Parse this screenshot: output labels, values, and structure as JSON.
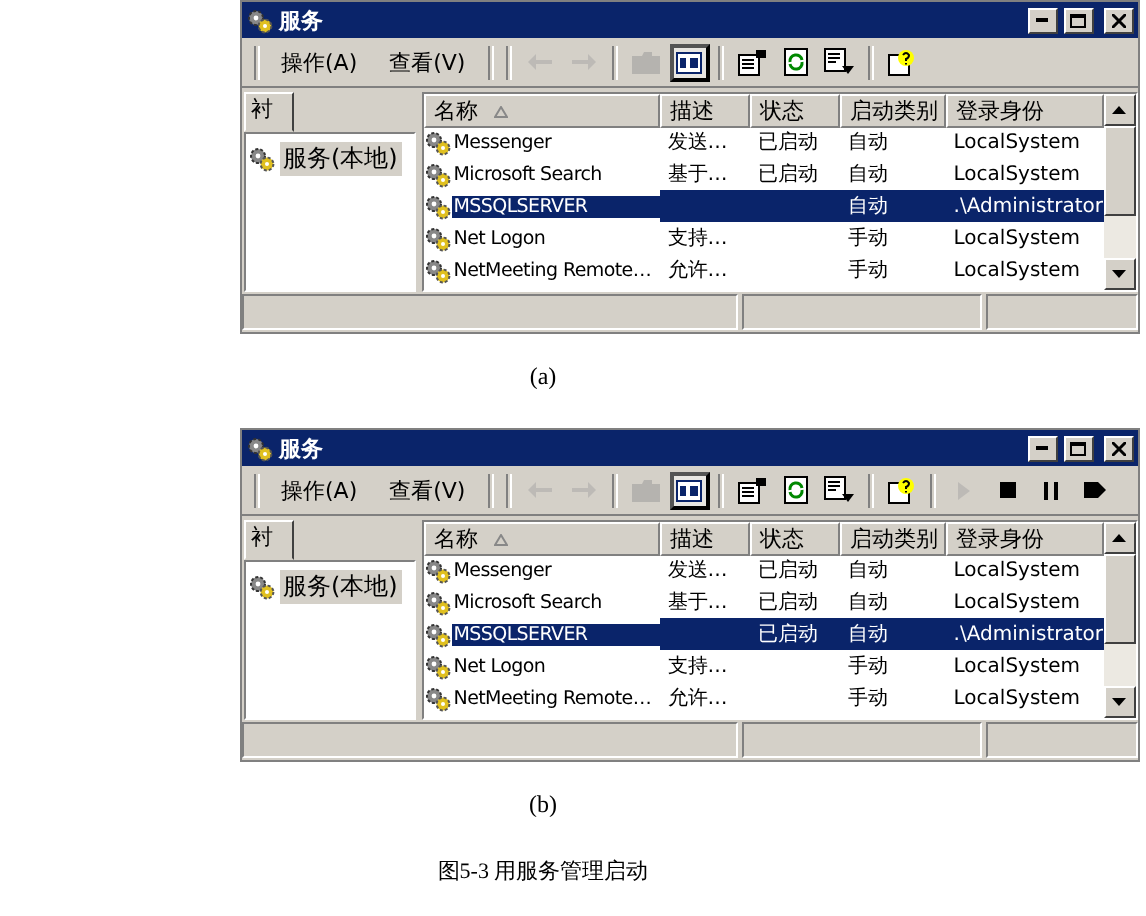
{
  "figures": [
    {
      "label": "(a)",
      "window": {
        "title": "服务",
        "menus": [
          "操作(A)",
          "查看(V)"
        ],
        "toolbar": [
          {
            "kind": "back",
            "disabled": true,
            "pressed": false
          },
          {
            "kind": "forward",
            "disabled": true,
            "pressed": false
          },
          {
            "kind": "sep"
          },
          {
            "kind": "folder",
            "disabled": true,
            "pressed": false
          },
          {
            "kind": "panes",
            "disabled": false,
            "pressed": true
          },
          {
            "kind": "sep"
          },
          {
            "kind": "properties",
            "disabled": false,
            "pressed": false
          },
          {
            "kind": "refresh",
            "disabled": false,
            "pressed": false
          },
          {
            "kind": "export",
            "disabled": false,
            "pressed": false
          },
          {
            "kind": "sep"
          },
          {
            "kind": "help",
            "disabled": false,
            "pressed": false
          }
        ],
        "tree": {
          "tab": "衬",
          "items": [
            {
              "label": "服务(本地)",
              "selected": true
            }
          ]
        },
        "columns": [
          "名称",
          "描述",
          "状态",
          "启动类别",
          "登录身份"
        ],
        "rows": [
          {
            "name": "Messenger",
            "description": "发送…",
            "status": "已启动",
            "startup": "自动",
            "logon": "LocalSystem",
            "selected": false
          },
          {
            "name": "Microsoft Search",
            "description": "基于…",
            "status": "已启动",
            "startup": "自动",
            "logon": "LocalSystem",
            "selected": false
          },
          {
            "name": "MSSQLSERVER",
            "description": "",
            "status": "",
            "startup": "自动",
            "logon": ".\\Administrator",
            "selected": true
          },
          {
            "name": "Net Logon",
            "description": "支持…",
            "status": "",
            "startup": "手动",
            "logon": "LocalSystem",
            "selected": false
          },
          {
            "name": "NetMeeting Remote…",
            "description": "允许…",
            "status": "",
            "startup": "手动",
            "logon": "LocalSystem",
            "selected": false
          }
        ]
      }
    },
    {
      "label": "(b)",
      "window": {
        "title": "服务",
        "menus": [
          "操作(A)",
          "查看(V)"
        ],
        "toolbar": [
          {
            "kind": "back",
            "disabled": true,
            "pressed": false
          },
          {
            "kind": "forward",
            "disabled": true,
            "pressed": false
          },
          {
            "kind": "sep"
          },
          {
            "kind": "folder",
            "disabled": true,
            "pressed": false
          },
          {
            "kind": "panes",
            "disabled": false,
            "pressed": true
          },
          {
            "kind": "sep"
          },
          {
            "kind": "properties",
            "disabled": false,
            "pressed": false
          },
          {
            "kind": "refresh",
            "disabled": false,
            "pressed": false
          },
          {
            "kind": "export",
            "disabled": false,
            "pressed": false
          },
          {
            "kind": "sep"
          },
          {
            "kind": "help",
            "disabled": false,
            "pressed": false
          },
          {
            "kind": "sep"
          },
          {
            "kind": "play",
            "disabled": true,
            "pressed": false
          },
          {
            "kind": "stop",
            "disabled": false,
            "pressed": false
          },
          {
            "kind": "pause",
            "disabled": false,
            "pressed": false
          },
          {
            "kind": "resume",
            "disabled": false,
            "pressed": false
          }
        ],
        "tree": {
          "tab": "衬",
          "items": [
            {
              "label": "服务(本地)",
              "selected": true
            }
          ]
        },
        "columns": [
          "名称",
          "描述",
          "状态",
          "启动类别",
          "登录身份"
        ],
        "rows": [
          {
            "name": "Messenger",
            "description": "发送…",
            "status": "已启动",
            "startup": "自动",
            "logon": "LocalSystem",
            "selected": false
          },
          {
            "name": "Microsoft Search",
            "description": "基于…",
            "status": "已启动",
            "startup": "自动",
            "logon": "LocalSystem",
            "selected": false
          },
          {
            "name": "MSSQLSERVER",
            "description": "",
            "status": "已启动",
            "startup": "自动",
            "logon": ".\\Administrator",
            "selected": true
          },
          {
            "name": "Net Logon",
            "description": "支持…",
            "status": "",
            "startup": "手动",
            "logon": "LocalSystem",
            "selected": false
          },
          {
            "name": "NetMeeting Remote…",
            "description": "允许…",
            "status": "",
            "startup": "手动",
            "logon": "LocalSystem",
            "selected": false
          }
        ]
      }
    }
  ],
  "caption": "图5-3 用服务管理启动"
}
